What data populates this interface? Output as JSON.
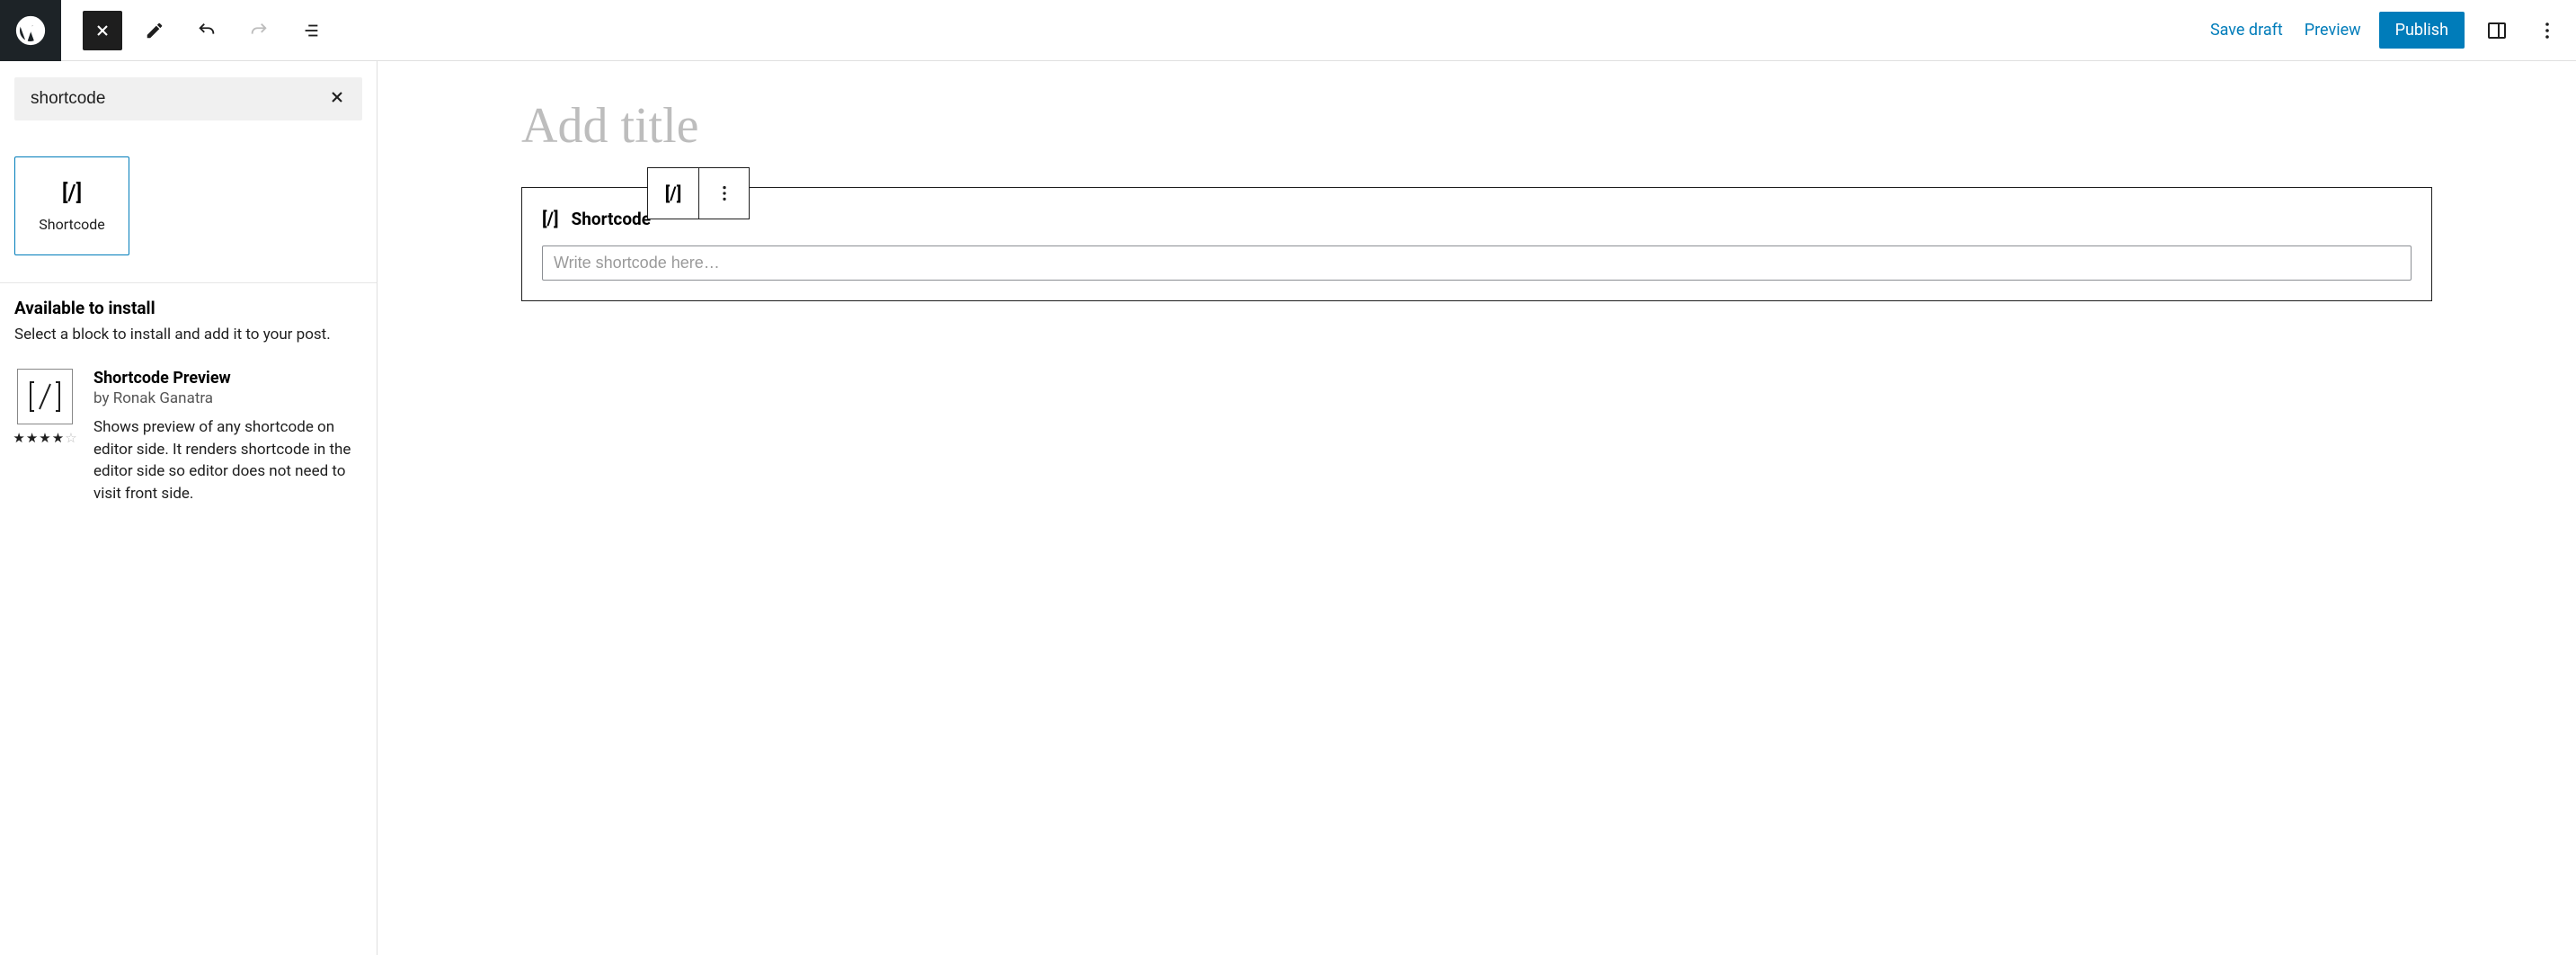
{
  "header": {
    "save_draft": "Save draft",
    "preview": "Preview",
    "publish": "Publish"
  },
  "sidebar": {
    "search_value": "shortcode",
    "block": {
      "label": "Shortcode"
    },
    "install": {
      "heading": "Available to install",
      "subheading": "Select a block to install and add it to your post.",
      "plugin": {
        "title": "Shortcode Preview",
        "author": "by Ronak Ganatra",
        "description": "Shows preview of any shortcode on editor side. It renders shortcode in the editor side so editor does not need to visit front side.",
        "rating": 4
      }
    }
  },
  "editor": {
    "title_placeholder": "Add title",
    "block": {
      "label": "Shortcode",
      "placeholder": "Write shortcode here…"
    }
  }
}
